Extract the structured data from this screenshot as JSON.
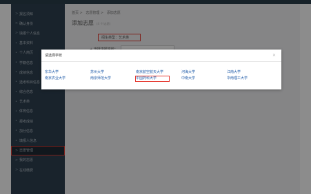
{
  "breadcrumb": [
    "首页 >",
    "志愿管理 >",
    "添加志愿"
  ],
  "page": {
    "title": "添加志愿",
    "subtitle": "(4 个/志愿)"
  },
  "form": {
    "major_label": "招生类型：艺术类",
    "school_label": "+ 选择填报学校："
  },
  "sidebar": {
    "items": [
      {
        "label": "报名须知",
        "arrow": ">"
      },
      {
        "label": "确认身份",
        "arrow": ">"
      },
      {
        "label": "填报个人信息",
        "arrow": ">"
      },
      {
        "label": "基本资料",
        "arrow": "•"
      },
      {
        "label": "个人简历",
        "arrow": "•"
      },
      {
        "label": "学籍信息",
        "arrow": "•"
      },
      {
        "label": "成绩信息",
        "arrow": "•"
      },
      {
        "label": "选考科目信息",
        "arrow": "•"
      },
      {
        "label": "综合信息",
        "arrow": "•"
      },
      {
        "label": "艺术类",
        "arrow": "•"
      },
      {
        "label": "体育信息",
        "arrow": "•"
      },
      {
        "label": "报考成绩",
        "arrow": "•"
      },
      {
        "label": "加分信息",
        "arrow": "•"
      },
      {
        "label": "填报人信息",
        "arrow": "•"
      },
      {
        "label": "志愿管理",
        "arrow": ">"
      },
      {
        "label": "我的志愿",
        "arrow": ">"
      },
      {
        "label": "在线缴费",
        "arrow": ">"
      }
    ]
  },
  "modal": {
    "title": "请选择学校",
    "close_icon": "close-icon",
    "schools": [
      "东华大学",
      "苏州大学",
      "南京航空航天大学",
      "河海大学",
      "江南大学",
      "南京农业大学",
      "南京师范大学",
      "中国药科大学",
      "中南大学",
      "华南理工大学"
    ],
    "selected_school": "中国药科大学"
  },
  "colors": {
    "sidebar": "#2f4050",
    "highlight": "#e63b32",
    "link": "#1e5aa8"
  }
}
